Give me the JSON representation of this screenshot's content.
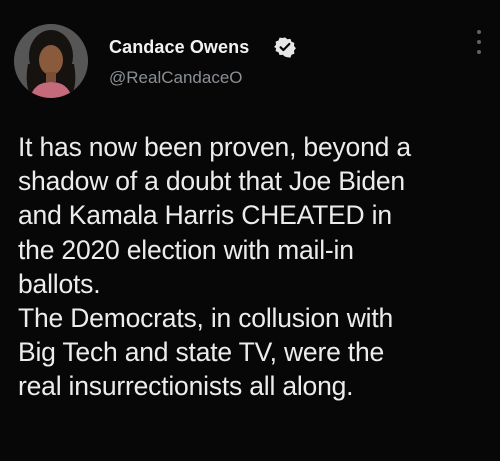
{
  "author": {
    "display_name": "Candace Owens",
    "handle": "@RealCandaceO",
    "verified": true,
    "avatar_icon": "profile-photo",
    "verified_icon": "verified-badge-icon"
  },
  "menu_icon": "more-options-icon",
  "tweet": {
    "lines": [
      "It has now been proven, beyond a",
      "shadow of a doubt that Joe Biden",
      "and Kamala Harris CHEATED in",
      "the 2020 election with mail-in",
      "ballots.",
      "The Democrats, in collusion with",
      "Big Tech and state TV, were the",
      "real insurrectionists all along."
    ]
  },
  "colors": {
    "background": "#070707",
    "text": "#ececec",
    "handle": "#8a8f94"
  }
}
